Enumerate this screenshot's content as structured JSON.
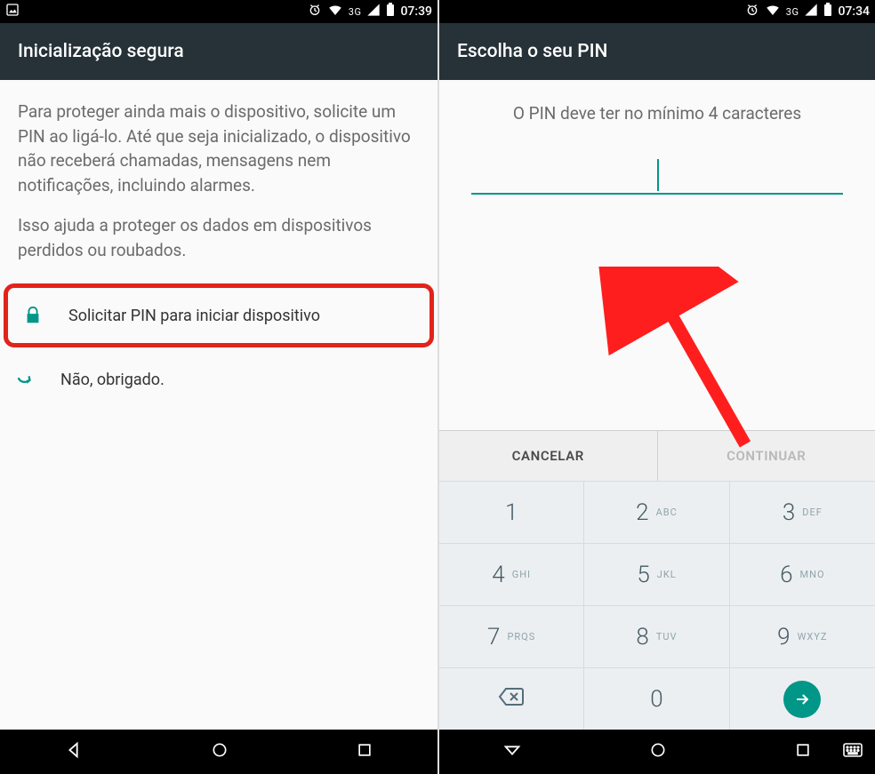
{
  "left": {
    "status": {
      "network": "3G",
      "time": "07:39"
    },
    "title": "Inicialização segura",
    "para1": "Para proteger ainda mais o dispositivo, solicite um PIN ao ligá-lo. Até que seja inicializado, o dispositivo não receberá chamadas, mensagens nem notificações, incluindo alarmes.",
    "para2": "Isso ajuda a proteger os dados em dispositivos perdidos ou roubados.",
    "option_require": "Solicitar PIN para iniciar dispositivo",
    "option_no": "Não, obrigado."
  },
  "right": {
    "status": {
      "network": "3G",
      "time": "07:34"
    },
    "title": "Escolha o seu PIN",
    "instruction": "O PIN deve ter no mínimo 4 caracteres",
    "cancel": "CANCELAR",
    "continue": "CONTINUAR",
    "keys": [
      {
        "d": "1",
        "l": ""
      },
      {
        "d": "2",
        "l": "ABC"
      },
      {
        "d": "3",
        "l": "DEF"
      },
      {
        "d": "4",
        "l": "GHI"
      },
      {
        "d": "5",
        "l": "JKL"
      },
      {
        "d": "6",
        "l": "MNO"
      },
      {
        "d": "7",
        "l": "PRQS"
      },
      {
        "d": "8",
        "l": "TUV"
      },
      {
        "d": "9",
        "l": "WXYZ"
      },
      {
        "d": "bksp",
        "l": ""
      },
      {
        "d": "0",
        "l": ""
      },
      {
        "d": "go",
        "l": ""
      }
    ]
  },
  "colors": {
    "accent": "#009688",
    "highlight": "#e2231a"
  }
}
